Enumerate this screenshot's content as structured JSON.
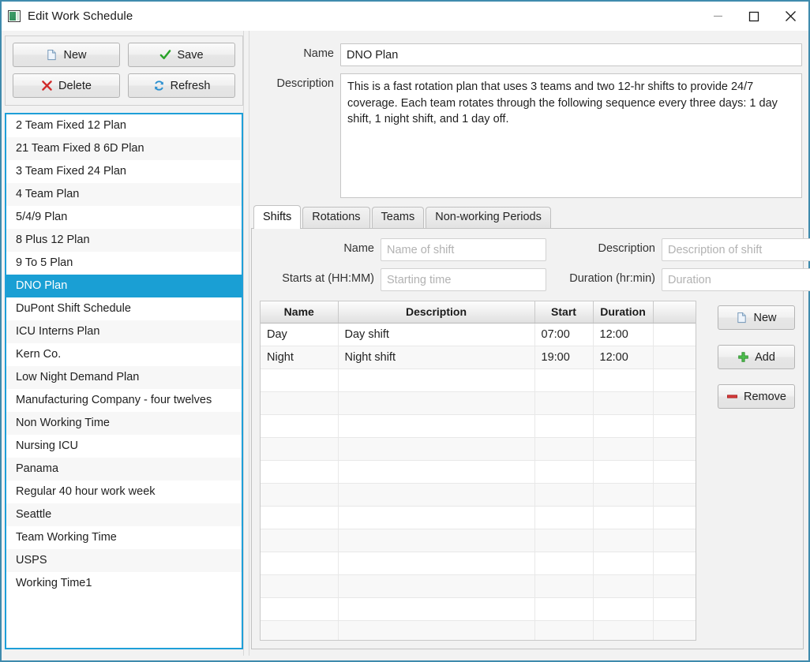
{
  "window": {
    "title": "Edit Work Schedule",
    "icon": "app-icon",
    "controls": {
      "minimize": "minimize-icon",
      "maximize": "maximize-icon",
      "close": "close-icon"
    },
    "border_color": "#3f8bad"
  },
  "toolbar": {
    "buttons": [
      {
        "label": "New",
        "icon": "new-document-icon"
      },
      {
        "label": "Save",
        "icon": "green-check-icon"
      },
      {
        "label": "Delete",
        "icon": "red-x-icon"
      },
      {
        "label": "Refresh",
        "icon": "refresh-icon"
      }
    ]
  },
  "plan_list": {
    "selected_index": 7,
    "selection_color": "#1a9fd4",
    "items": [
      "2 Team Fixed 12 Plan",
      "21 Team Fixed 8 6D Plan",
      "3 Team Fixed 24 Plan",
      "4 Team Plan",
      "5/4/9 Plan",
      "8 Plus 12 Plan",
      "9 To 5 Plan",
      "DNO Plan",
      "DuPont Shift Schedule",
      "ICU Interns Plan",
      "Kern Co.",
      "Low Night Demand Plan",
      "Manufacturing Company - four twelves",
      "Non Working Time",
      "Nursing ICU",
      "Panama",
      "Regular 40 hour work week",
      "Seattle",
      "Team Working Time",
      "USPS",
      "Working Time1"
    ]
  },
  "header_form": {
    "name_label": "Name",
    "name_value": "DNO Plan",
    "description_label": "Description",
    "description_value": "This is a fast rotation plan that uses 3 teams and two 12-hr shifts to provide 24/7 coverage. Each team rotates through the following sequence every three days: 1 day shift, 1 night shift, and 1 day off."
  },
  "tabs": {
    "active": "Shifts",
    "items": [
      "Shifts",
      "Rotations",
      "Teams",
      "Non-working Periods"
    ]
  },
  "shift_form": {
    "name_label": "Name",
    "name_value": "",
    "name_placeholder": "Name of shift",
    "description_label": "Description",
    "description_value": "",
    "description_placeholder": "Description of shift",
    "starts_label": "Starts at (HH:MM)",
    "starts_value": "",
    "starts_placeholder": "Starting time",
    "duration_label": "Duration (hr:min)",
    "duration_value": "",
    "duration_placeholder": "Duration"
  },
  "shift_table": {
    "columns": [
      "Name",
      "Description",
      "Start",
      "Duration",
      ""
    ],
    "rows": [
      {
        "name": "Day",
        "description": "Day shift",
        "start": "07:00",
        "duration": "12:00",
        "extra": ""
      },
      {
        "name": "Night",
        "description": "Night shift",
        "start": "19:00",
        "duration": "12:00",
        "extra": ""
      }
    ],
    "empty_row_count": 12
  },
  "side_buttons": [
    {
      "label": "New",
      "icon": "new-document-icon"
    },
    {
      "label": "Add",
      "icon": "green-plus-icon"
    },
    {
      "label": "Remove",
      "icon": "red-minus-icon"
    }
  ]
}
